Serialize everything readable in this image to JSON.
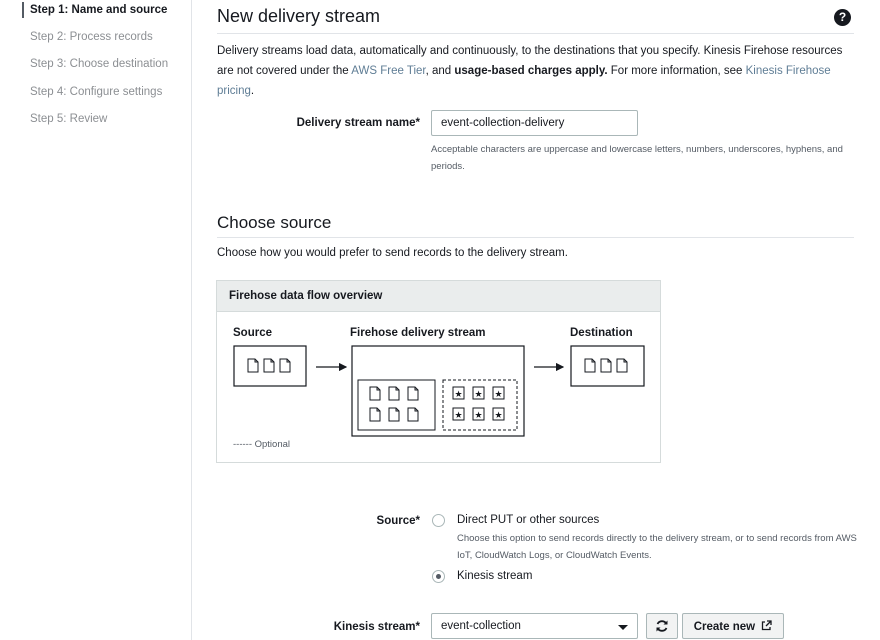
{
  "steps": [
    {
      "label": "Step 1: Name and source",
      "active": true
    },
    {
      "label": "Step 2: Process records",
      "active": false
    },
    {
      "label": "Step 3: Choose destination",
      "active": false
    },
    {
      "label": "Step 4: Configure settings",
      "active": false
    },
    {
      "label": "Step 5: Review",
      "active": false
    }
  ],
  "page": {
    "title": "New delivery stream",
    "help_icon": "question-circle-icon",
    "intro": {
      "part1": "Delivery streams load data, automatically and continuously, to the destinations that you specify. Kinesis Firehose resources are not covered under the ",
      "link1": "AWS Free Tier",
      "part2": ", and ",
      "bold1": "usage-based charges apply.",
      "part3": " For more information, see ",
      "link2": "Kinesis Firehose pricing",
      "part4": "."
    }
  },
  "name_field": {
    "label": "Delivery stream name*",
    "value": "event-collection-delivery",
    "hint": "Acceptable characters are uppercase and lowercase letters, numbers, underscores, hyphens, and periods."
  },
  "choose_source": {
    "title": "Choose source",
    "description": "Choose how you would prefer to send records to the delivery stream."
  },
  "diagram": {
    "title": "Firehose data flow overview",
    "source_label": "Source",
    "firehose_label": "Firehose delivery stream",
    "destination_label": "Destination",
    "source_records": "Source records",
    "processed_records": "Processed records",
    "optional": "------ Optional"
  },
  "source_field": {
    "label": "Source*",
    "options": [
      {
        "label": "Direct PUT or other sources",
        "description": "Choose this option to send records directly to the delivery stream, or to send records from AWS IoT, CloudWatch Logs, or CloudWatch Events.",
        "selected": false
      },
      {
        "label": "Kinesis stream",
        "description": "",
        "selected": true
      }
    ]
  },
  "kinesis_field": {
    "label": "Kinesis stream*",
    "value": "event-collection",
    "refresh_icon": "refresh-icon",
    "create_label": "Create new",
    "external_icon": "external-link-icon"
  }
}
